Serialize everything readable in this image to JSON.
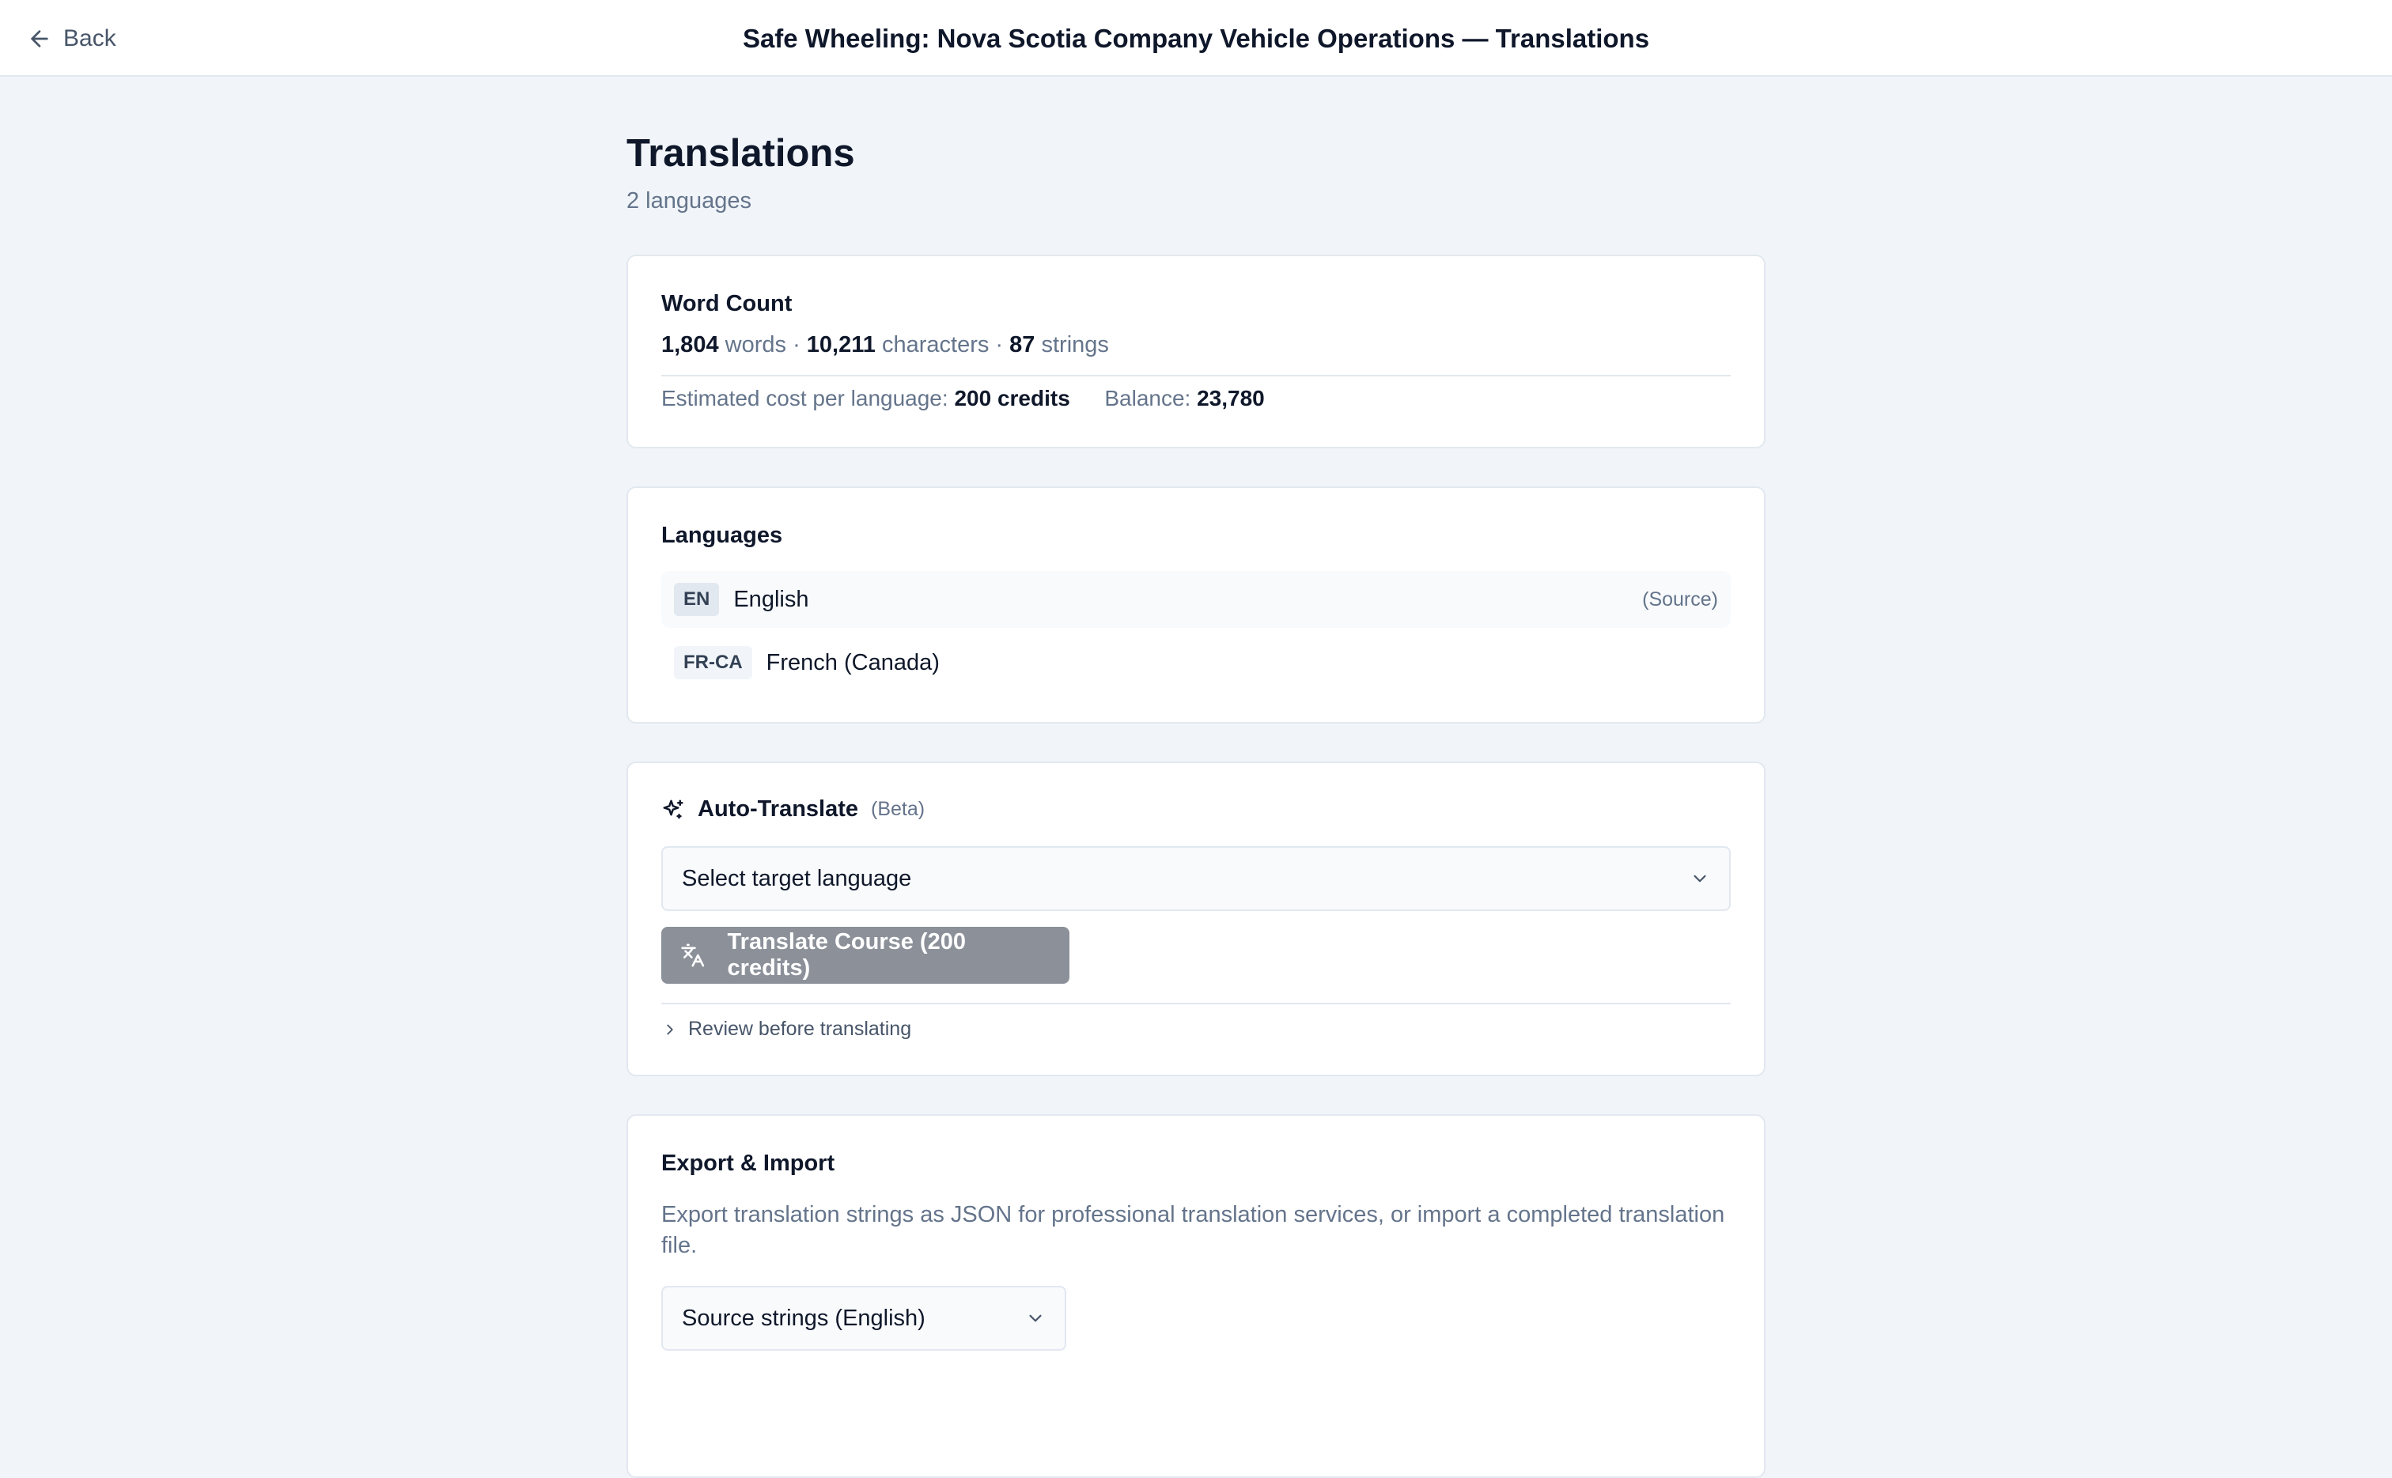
{
  "header": {
    "back_label": "Back",
    "title": "Safe Wheeling: Nova Scotia Company Vehicle Operations — Translations"
  },
  "page": {
    "heading": "Translations",
    "subtitle": "2 languages"
  },
  "word_count": {
    "title": "Word Count",
    "words_value": "1,804",
    "words_label": "words",
    "characters_value": "10,211",
    "characters_label": "characters",
    "strings_value": "87",
    "strings_label": "strings",
    "separator": "·",
    "cost_label": "Estimated cost per language:",
    "cost_value": "200 credits",
    "balance_label": "Balance:",
    "balance_value": "23,780"
  },
  "languages": {
    "title": "Languages",
    "items": [
      {
        "code": "EN",
        "name": "English",
        "tag": "(Source)"
      },
      {
        "code": "FR-CA",
        "name": "French (Canada)",
        "tag": ""
      }
    ]
  },
  "auto_translate": {
    "title": "Auto-Translate",
    "badge": "(Beta)",
    "select_placeholder": "Select target language",
    "button_label": "Translate Course (200 credits)",
    "review_label": "Review before translating"
  },
  "export_import": {
    "title": "Export & Import",
    "description": "Export translation strings as JSON for professional translation services, or import a completed translation file.",
    "select_value": "Source strings (English)"
  },
  "colors": {
    "background": "#f1f5f9",
    "card": "#ffffff",
    "border": "#e2e8f0",
    "muted_text": "#64748b",
    "disabled_button": "#8b9099"
  },
  "icons": {
    "back": "arrow-left-icon",
    "auto_translate": "sparkles-icon",
    "translate": "languages-icon",
    "select": "chevron-down-icon",
    "review": "chevron-right-icon"
  }
}
